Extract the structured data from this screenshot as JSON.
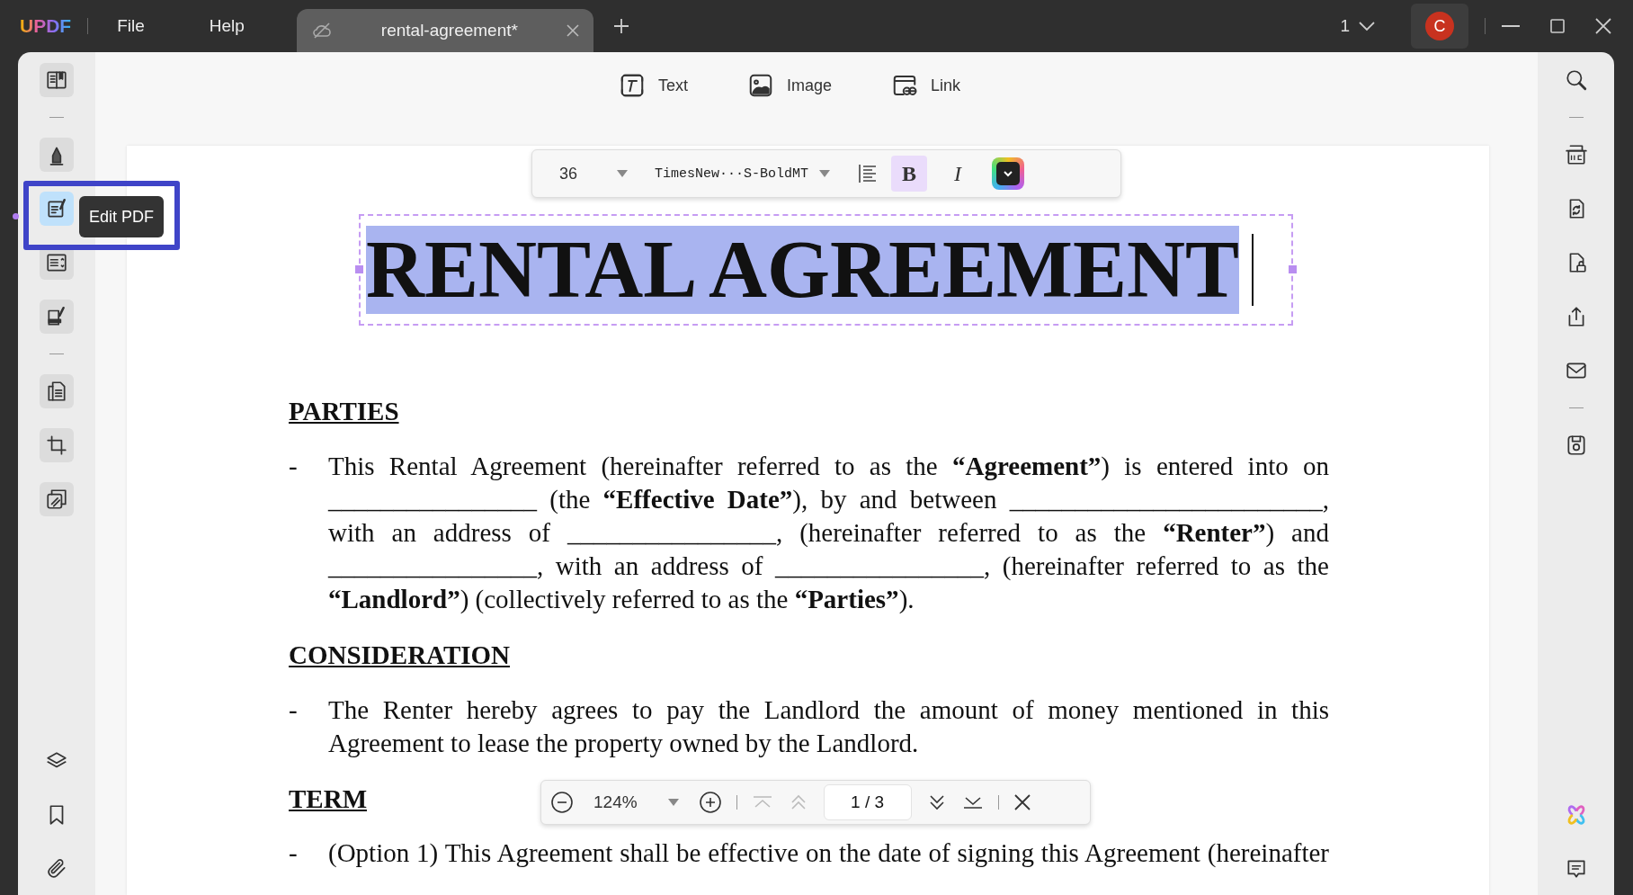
{
  "app": {
    "logo": "UPDF",
    "menu": [
      "File",
      "Help"
    ]
  },
  "tabs": [
    {
      "label": "rental-agreement*",
      "selected": true
    }
  ],
  "page_menu": "1",
  "avatar": "C",
  "left_tools": [
    [
      {
        "kind": "reader",
        "selected": false
      }
    ],
    [
      {
        "kind": "comment",
        "selected": false
      },
      {
        "kind": "edit",
        "selected": true
      },
      {
        "kind": "form",
        "selected": false
      },
      {
        "kind": "sign",
        "selected": false
      }
    ],
    [
      {
        "kind": "organize",
        "selected": false
      },
      {
        "kind": "crop",
        "selected": false
      },
      {
        "kind": "pages",
        "selected": false
      }
    ]
  ],
  "left_bottom_tools": [
    {
      "kind": "layers"
    },
    {
      "kind": "bookmark"
    },
    {
      "kind": "attachment"
    }
  ],
  "tooltip": "Edit PDF",
  "insert_tools": [
    {
      "kind": "text",
      "label": "Text"
    },
    {
      "kind": "image",
      "label": "Image"
    },
    {
      "kind": "link",
      "label": "Link"
    }
  ],
  "format_bar": {
    "font_size": "36",
    "font_name": "TimesNew···S-BoldMT",
    "bold_label": "B",
    "bold": true,
    "italic_label": "I",
    "italic": false
  },
  "document": {
    "title": "RENTAL AGREEMENT",
    "title_selected": true,
    "sections": [
      {
        "heading": "PARTIES",
        "items": [
          "This Rental Agreement (hereinafter referred to as the **“Agreement”**) is entered into on ________________ (the **“Effective Date”**), by and between ________________________, with an address of ________________, (hereinafter referred to as the **“Renter”**) and ________________, with an address of ________________, (hereinafter referred to as the **“Landlord”**) (collectively referred to as the **“Parties”**)."
        ]
      },
      {
        "heading": "CONSIDERATION",
        "items": [
          "The Renter hereby agrees to pay the Landlord the amount of money mentioned in this Agreement to lease the property owned by the Landlord."
        ]
      },
      {
        "heading": "TERM",
        "items": [
          "(Option 1) This Agreement shall be effective on the date of signing this Agreement (hereinafter"
        ]
      }
    ],
    "bullet": "-"
  },
  "zoom_bar": {
    "zoom": "124%",
    "page": "1 / 3"
  },
  "right_tools": [
    [
      {
        "kind": "search"
      }
    ],
    [
      {
        "kind": "ocr"
      },
      {
        "kind": "convert"
      },
      {
        "kind": "protect"
      },
      {
        "kind": "share"
      },
      {
        "kind": "mail"
      }
    ],
    [
      {
        "kind": "save"
      }
    ]
  ],
  "right_bottom_tools": [
    {
      "kind": "ai"
    },
    {
      "kind": "comments"
    }
  ]
}
